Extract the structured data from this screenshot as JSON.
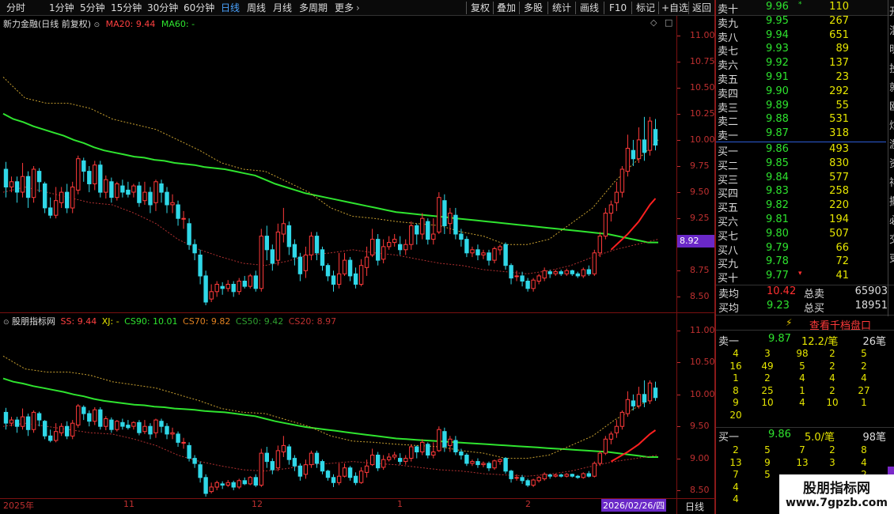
{
  "toolbar": {
    "periods": [
      "分时",
      "1分钟",
      "5分钟",
      "15分钟",
      "30分钟",
      "60分钟",
      "日线",
      "周线",
      "月线",
      "多周期",
      "更多"
    ],
    "active_period": "日线",
    "tools": [
      "复权",
      "叠加",
      "多股",
      "统计",
      "画线",
      "F10",
      "标记",
      "+自选",
      "返回"
    ]
  },
  "main_chart": {
    "header": {
      "name": "新力金融(日线 前复权)",
      "ma20": "MA20: 9.44",
      "ma60": "MA60: -"
    },
    "current_price_tag": "8.92"
  },
  "sub_chart": {
    "header": {
      "name": "股朋指标网",
      "ss": "SS: 9.44",
      "xj": "XJ: -",
      "cs90": "CS90: 10.01",
      "cs70": "CS70: 9.82",
      "cs50": "CS50: 9.42",
      "cs20": "CS20: 8.97"
    }
  },
  "date_axis": {
    "labels": [
      "2025年",
      "11",
      "12",
      "1",
      "2"
    ],
    "current_date": "2026/02/26/四",
    "period_label": "日线"
  },
  "chart_data": [
    {
      "type": "candlestick",
      "name": "main",
      "y_ticks": [
        "11.00",
        "10.75",
        "10.50",
        "10.25",
        "10.00",
        "9.75",
        "9.50",
        "9.25",
        "9.00",
        "8.75",
        "8.50"
      ],
      "ylim": [
        8.45,
        11.05
      ],
      "ohlc": [
        [
          9.72,
          9.55,
          9.45,
          9.79
        ],
        [
          9.55,
          9.6,
          9.5,
          9.65
        ],
        [
          9.6,
          9.5,
          9.4,
          9.65
        ],
        [
          9.5,
          9.65,
          9.45,
          9.78
        ],
        [
          9.65,
          9.45,
          9.35,
          9.7
        ],
        [
          9.45,
          9.72,
          9.4,
          9.75
        ],
        [
          9.7,
          9.6,
          9.5,
          9.73
        ],
        [
          9.58,
          9.35,
          9.3,
          9.6
        ],
        [
          9.35,
          9.28,
          9.25,
          9.45
        ],
        [
          9.28,
          9.42,
          9.25,
          9.55
        ],
        [
          9.4,
          9.5,
          9.35,
          9.55
        ],
        [
          9.5,
          9.35,
          9.3,
          9.58
        ],
        [
          9.35,
          9.55,
          9.3,
          9.6
        ],
        [
          9.52,
          9.82,
          9.48,
          9.85
        ],
        [
          9.8,
          9.7,
          9.6,
          9.83
        ],
        [
          9.7,
          9.58,
          9.5,
          9.75
        ],
        [
          9.58,
          9.76,
          9.52,
          9.8
        ],
        [
          9.76,
          9.5,
          9.45,
          9.8
        ],
        [
          9.5,
          9.62,
          9.44,
          9.66
        ],
        [
          9.6,
          9.45,
          9.4,
          9.64
        ],
        [
          9.45,
          9.58,
          9.42,
          9.6
        ],
        [
          9.56,
          9.5,
          9.45,
          9.62
        ],
        [
          9.52,
          9.48,
          9.45,
          9.6
        ],
        [
          9.5,
          9.56,
          9.45,
          9.58
        ],
        [
          9.56,
          9.4,
          9.36,
          9.6
        ],
        [
          9.42,
          9.5,
          9.38,
          9.6
        ],
        [
          9.5,
          9.38,
          9.3,
          9.55
        ],
        [
          9.4,
          9.6,
          9.32,
          9.62
        ],
        [
          9.58,
          9.5,
          9.4,
          9.62
        ],
        [
          9.5,
          9.38,
          9.3,
          9.55
        ],
        [
          9.38,
          9.4,
          9.3,
          9.48
        ],
        [
          9.38,
          9.25,
          9.18,
          9.42
        ],
        [
          9.25,
          9.25,
          9.15,
          9.32
        ],
        [
          9.2,
          9.0,
          8.95,
          9.25
        ],
        [
          9.0,
          8.92,
          8.85,
          9.05
        ],
        [
          8.9,
          8.7,
          8.62,
          8.95
        ],
        [
          8.7,
          8.45,
          8.4,
          8.75
        ],
        [
          8.48,
          8.55,
          8.45,
          8.62
        ],
        [
          8.55,
          8.62,
          8.5,
          8.65
        ],
        [
          8.6,
          8.58,
          8.52,
          8.64
        ],
        [
          8.58,
          8.62,
          8.55,
          8.66
        ],
        [
          8.62,
          8.55,
          8.5,
          8.65
        ],
        [
          8.55,
          8.65,
          8.52,
          8.68
        ],
        [
          8.65,
          8.6,
          8.58,
          8.7
        ],
        [
          8.6,
          8.7,
          8.58,
          8.72
        ],
        [
          8.7,
          8.58,
          8.55,
          8.75
        ],
        [
          8.58,
          9.08,
          8.55,
          9.15
        ],
        [
          9.08,
          8.95,
          8.85,
          9.18
        ],
        [
          8.95,
          8.82,
          8.75,
          9.0
        ],
        [
          8.85,
          9.12,
          8.8,
          9.2
        ],
        [
          9.1,
          9.2,
          9.02,
          9.35
        ],
        [
          9.18,
          8.98,
          8.9,
          9.22
        ],
        [
          9.0,
          8.88,
          8.8,
          9.05
        ],
        [
          8.88,
          8.72,
          8.65,
          8.92
        ],
        [
          8.75,
          8.9,
          8.68,
          8.98
        ],
        [
          8.9,
          9.08,
          8.85,
          9.12
        ],
        [
          9.08,
          8.92,
          8.85,
          9.12
        ],
        [
          8.95,
          8.8,
          8.75,
          8.98
        ],
        [
          8.8,
          8.7,
          8.65,
          8.82
        ],
        [
          8.7,
          8.62,
          8.55,
          8.75
        ],
        [
          8.62,
          8.72,
          8.58,
          8.92
        ],
        [
          8.72,
          8.85,
          8.7,
          8.92
        ],
        [
          8.85,
          8.7,
          8.65,
          8.88
        ],
        [
          8.72,
          8.62,
          8.58,
          8.78
        ],
        [
          8.62,
          8.8,
          8.6,
          8.86
        ],
        [
          8.78,
          8.88,
          8.7,
          8.98
        ],
        [
          8.9,
          9.05,
          8.88,
          9.15
        ],
        [
          9.05,
          8.85,
          8.8,
          9.1
        ],
        [
          8.86,
          8.98,
          8.82,
          9.05
        ],
        [
          8.98,
          9.02,
          8.95,
          9.08
        ],
        [
          9.02,
          9.05,
          8.98,
          9.1
        ],
        [
          9.0,
          8.95,
          8.9,
          9.08
        ],
        [
          8.95,
          9.0,
          8.9,
          9.05
        ],
        [
          9.0,
          9.18,
          8.95,
          9.22
        ],
        [
          9.18,
          9.1,
          9.0,
          9.2
        ],
        [
          9.1,
          9.25,
          9.05,
          9.3
        ],
        [
          9.22,
          9.05,
          9.0,
          9.25
        ],
        [
          9.05,
          9.1,
          9.0,
          9.25
        ],
        [
          9.12,
          9.45,
          9.1,
          9.5
        ],
        [
          9.42,
          9.18,
          9.1,
          9.48
        ],
        [
          9.2,
          9.3,
          9.1,
          9.35
        ],
        [
          9.28,
          9.1,
          9.05,
          9.35
        ],
        [
          9.1,
          9.05,
          8.98,
          9.15
        ],
        [
          9.05,
          8.92,
          8.88,
          9.08
        ],
        [
          8.92,
          8.95,
          8.88,
          8.98
        ],
        [
          8.95,
          8.9,
          8.85,
          9.0
        ],
        [
          8.9,
          8.92,
          8.86,
          8.95
        ],
        [
          8.92,
          8.85,
          8.8,
          8.95
        ],
        [
          8.85,
          8.96,
          8.82,
          8.98
        ],
        [
          8.95,
          8.98,
          8.9,
          9.0
        ],
        [
          9.0,
          8.8,
          8.76,
          9.02
        ],
        [
          8.8,
          8.68,
          8.62,
          8.82
        ],
        [
          8.7,
          8.7,
          8.65,
          8.75
        ],
        [
          8.7,
          8.65,
          8.6,
          8.74
        ],
        [
          8.65,
          8.58,
          8.55,
          8.68
        ],
        [
          8.58,
          8.66,
          8.55,
          8.68
        ],
        [
          8.65,
          8.7,
          8.62,
          8.72
        ],
        [
          8.68,
          8.75,
          8.65,
          8.78
        ],
        [
          8.74,
          8.72,
          8.68,
          8.76
        ],
        [
          8.72,
          8.74,
          8.7,
          8.76
        ],
        [
          8.74,
          8.72,
          8.7,
          8.76
        ],
        [
          8.72,
          8.75,
          8.7,
          8.77
        ],
        [
          8.75,
          8.72,
          8.7,
          8.76
        ],
        [
          8.72,
          8.7,
          8.68,
          8.74
        ],
        [
          8.7,
          8.76,
          8.68,
          8.78
        ],
        [
          8.76,
          8.72,
          8.7,
          8.8
        ],
        [
          8.72,
          8.92,
          8.7,
          8.95
        ],
        [
          8.92,
          9.08,
          8.88,
          9.12
        ],
        [
          9.08,
          9.3,
          9.05,
          9.35
        ],
        [
          9.3,
          9.38,
          9.22,
          9.42
        ],
        [
          9.4,
          9.5,
          9.32,
          9.6
        ],
        [
          9.5,
          9.72,
          9.45,
          9.75
        ],
        [
          9.7,
          9.92,
          9.65,
          10.05
        ],
        [
          9.9,
          9.82,
          9.75,
          10.0
        ],
        [
          9.82,
          10.0,
          9.78,
          10.12
        ],
        [
          10.0,
          9.88,
          9.8,
          10.22
        ],
        [
          9.9,
          10.18,
          9.85,
          10.22
        ],
        [
          10.1,
          9.95,
          9.9,
          10.2
        ]
      ],
      "lines": [
        {
          "name": "MA-green",
          "color": "#2fe42f",
          "values": [
            10.25,
            10.2,
            10.17,
            10.13,
            10.1,
            10.07,
            10.04,
            10.0,
            9.97,
            9.93,
            9.9,
            9.88,
            9.86,
            9.84,
            9.83,
            9.81,
            9.8,
            9.78,
            9.77,
            9.76,
            9.74,
            9.73,
            9.72,
            9.7,
            9.68,
            9.66,
            9.62,
            9.58,
            9.55,
            9.52,
            9.49,
            9.47,
            9.45,
            9.43,
            9.41,
            9.39,
            9.37,
            9.35,
            9.33,
            9.31,
            9.3,
            9.29,
            9.28,
            9.27,
            9.26,
            9.25,
            9.24,
            9.23,
            9.22,
            9.21,
            9.2,
            9.19,
            9.18,
            9.17,
            9.16,
            9.15,
            9.14,
            9.13,
            9.12,
            9.11,
            9.1,
            9.08,
            9.06,
            9.04,
            9.02,
            9.02
          ]
        },
        {
          "name": "CS-upper",
          "color": "#c8a030",
          "values": [
            10.6,
            10.4,
            10.35,
            10.35,
            10.3,
            10.2,
            10.15,
            10.1,
            10.0,
            9.9,
            9.78,
            9.72,
            9.7,
            9.6,
            9.5,
            9.35,
            9.27,
            9.25,
            9.22,
            9.2,
            9.18,
            9.12,
            9.08,
            9.0,
            9.0,
            9.05,
            9.2,
            9.35,
            9.6,
            9.8,
            10.0
          ]
        },
        {
          "name": "CS-lower",
          "color": "#b03030",
          "values": [
            9.5,
            9.55,
            9.5,
            9.45,
            9.4,
            9.38,
            9.3,
            9.2,
            9.05,
            8.95,
            8.88,
            8.82,
            8.8,
            8.84,
            8.9,
            8.92,
            8.95,
            8.92,
            8.9,
            8.86,
            8.82,
            8.8,
            8.76,
            8.74,
            8.72,
            8.75,
            8.8,
            8.88,
            8.95,
            9.0,
            9.05
          ]
        },
        {
          "name": "SS-red",
          "color": "#ff2020",
          "values": [
            8.95,
            9.0,
            9.05,
            9.1,
            9.16,
            9.22,
            9.3,
            9.38,
            9.44
          ]
        }
      ]
    },
    {
      "type": "candlestick",
      "name": "sub",
      "y_ticks": [
        "11.00",
        "10.50",
        "10.00",
        "9.50",
        "9.00",
        "8.50"
      ],
      "ylim": [
        8.45,
        11.05
      ]
    }
  ],
  "order_book": {
    "sell": [
      {
        "label": "卖十",
        "price": "9.96",
        "volume": "110",
        "marker": "up"
      },
      {
        "label": "卖九",
        "price": "9.95",
        "volume": "267"
      },
      {
        "label": "卖八",
        "price": "9.94",
        "volume": "651"
      },
      {
        "label": "卖七",
        "price": "9.93",
        "volume": "89"
      },
      {
        "label": "卖六",
        "price": "9.92",
        "volume": "137"
      },
      {
        "label": "卖五",
        "price": "9.91",
        "volume": "23"
      },
      {
        "label": "卖四",
        "price": "9.90",
        "volume": "292"
      },
      {
        "label": "卖三",
        "price": "9.89",
        "volume": "55"
      },
      {
        "label": "卖二",
        "price": "9.88",
        "volume": "531"
      },
      {
        "label": "卖一",
        "price": "9.87",
        "volume": "318"
      }
    ],
    "buy": [
      {
        "label": "买一",
        "price": "9.86",
        "volume": "493"
      },
      {
        "label": "买二",
        "price": "9.85",
        "volume": "830"
      },
      {
        "label": "买三",
        "price": "9.84",
        "volume": "577"
      },
      {
        "label": "买四",
        "price": "9.83",
        "volume": "258"
      },
      {
        "label": "买五",
        "price": "9.82",
        "volume": "220"
      },
      {
        "label": "买六",
        "price": "9.81",
        "volume": "194"
      },
      {
        "label": "买七",
        "price": "9.80",
        "volume": "507"
      },
      {
        "label": "买八",
        "price": "9.79",
        "volume": "66"
      },
      {
        "label": "买九",
        "price": "9.78",
        "volume": "72"
      },
      {
        "label": "买十",
        "price": "9.77",
        "volume": "41",
        "marker": "down"
      }
    ],
    "avg_sell_label": "卖均",
    "avg_sell": "10.42",
    "total_sell_label": "总卖",
    "total_sell": "65903",
    "avg_buy_label": "买均",
    "avg_buy": "9.23",
    "total_buy_label": "总买",
    "total_buy": "18951"
  },
  "level1000": {
    "button_label": "查看千档盘口",
    "sell1": {
      "label": "卖一",
      "price": "9.87",
      "per_order": "12.2/笔",
      "orders": "26笔",
      "queue": [
        [
          "4",
          "3",
          "98",
          "2",
          "5"
        ],
        [
          "16",
          "49",
          "5",
          "2",
          "2"
        ],
        [
          "1",
          "2",
          "4",
          "4",
          "4"
        ],
        [
          "8",
          "25",
          "1",
          "2",
          "27"
        ],
        [
          "9",
          "10",
          "4",
          "10",
          "1"
        ],
        [
          "20",
          "",
          "",
          "",
          ""
        ]
      ]
    },
    "buy1": {
      "label": "买一",
      "price": "9.86",
      "per_order": "5.0/笔",
      "orders": "98笔",
      "queue": [
        [
          "2",
          "5",
          "7",
          "2",
          "8"
        ],
        [
          "13",
          "9",
          "13",
          "3",
          "4"
        ],
        [
          "7",
          "5",
          "",
          "",
          "2"
        ],
        [
          "4",
          "",
          "",
          "",
          ""
        ],
        [
          "4",
          "",
          "",
          "",
          ""
        ]
      ]
    }
  },
  "right_edge_chars": [
    "开",
    "混",
    "明",
    "投",
    "就",
    "欧",
    "炫",
    "游",
    "资",
    "祥",
    "撒",
    "必",
    "交",
    "吏"
  ],
  "watermark": {
    "title": "股朋指标网",
    "url": "www.7gpzb.com"
  }
}
